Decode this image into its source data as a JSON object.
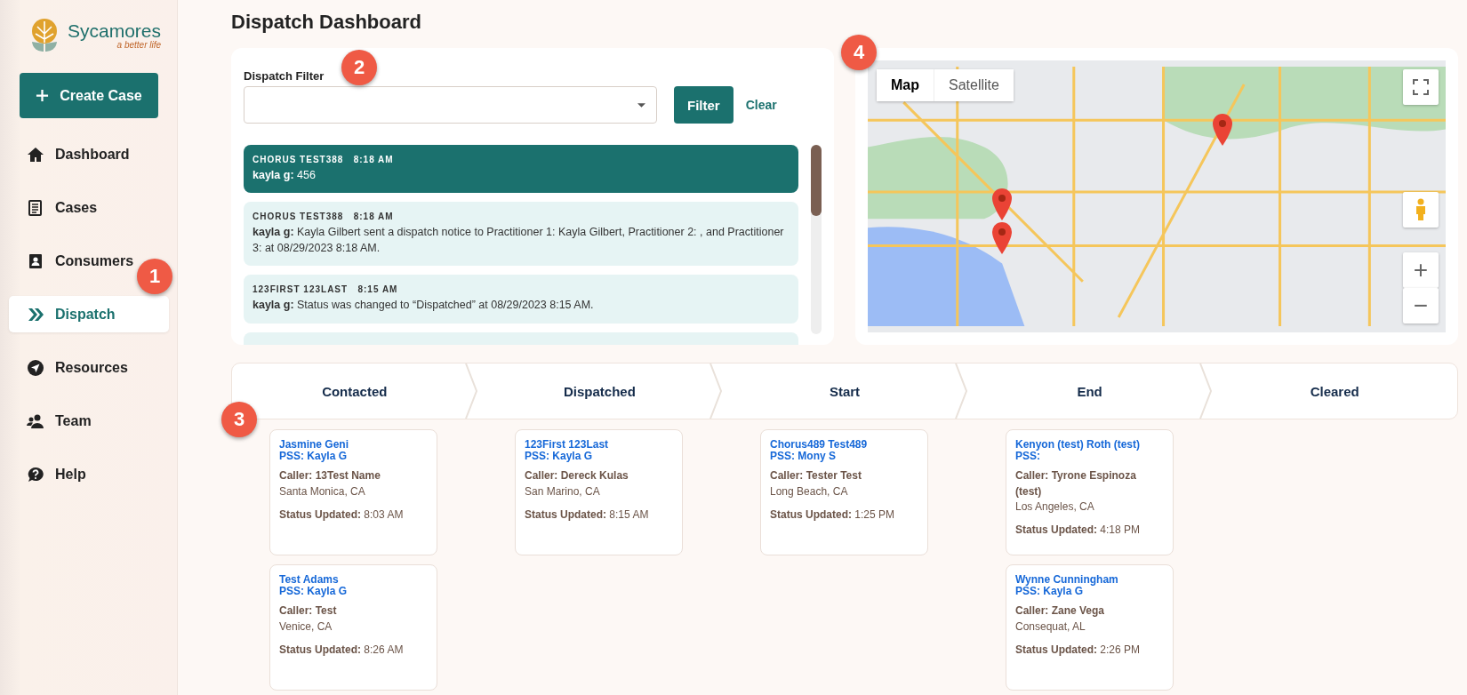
{
  "brand": {
    "name": "Sycamores",
    "tagline": "a better life"
  },
  "create_button": {
    "label": "Create Case"
  },
  "nav": [
    {
      "label": "Dashboard",
      "kind": "home",
      "selected": false
    },
    {
      "label": "Cases",
      "kind": "cases",
      "selected": false
    },
    {
      "label": "Consumers",
      "kind": "consumers",
      "selected": false
    },
    {
      "label": "Dispatch",
      "kind": "dispatch",
      "selected": true
    },
    {
      "label": "Resources",
      "kind": "resources",
      "selected": false
    },
    {
      "label": "Team",
      "kind": "team",
      "selected": false
    },
    {
      "label": "Help",
      "kind": "help",
      "selected": false
    }
  ],
  "page_title": "Dispatch Dashboard",
  "filter": {
    "label": "Dispatch Filter",
    "filter_button": "Filter",
    "clear_link": "Clear"
  },
  "messages": [
    {
      "header": "CHORUS TEST388   8:18 AM",
      "body": "**kayla g:** 456",
      "selected": true
    },
    {
      "header": "CHORUS TEST388   8:18 AM",
      "body": "**kayla g:** Kayla Gilbert sent a dispatch notice to Practitioner 1: Kayla Gilbert, Practitioner 2: , and Practitioner 3: at 08/29/2023 8:18 AM.",
      "selected": false
    },
    {
      "header": "123FIRST 123LAST   8:15 AM",
      "body": "**kayla g:** Status was changed to “Dispatched” at 08/29/2023 8:15 AM.",
      "selected": false
    }
  ],
  "map": {
    "tabs": [
      {
        "label": "Map",
        "selected": true
      },
      {
        "label": "Satellite",
        "selected": false
      }
    ],
    "zoom_in": "+",
    "zoom_out": "−"
  },
  "stages": [
    {
      "title": "Contacted",
      "cards": [
        {
          "name": "Jasmine Geni",
          "pss": "PSS: Kayla G",
          "caller": "Caller: 13Test Name",
          "location": "Santa Monica, CA",
          "status": "**Status Updated:** 8:03 AM"
        },
        {
          "name": "Test Adams",
          "pss": "PSS: Kayla G",
          "caller": "Caller: Test",
          "location": "Venice, CA",
          "status": "**Status Updated:** 8:26 AM"
        }
      ]
    },
    {
      "title": "Dispatched",
      "cards": [
        {
          "name": "123First 123Last",
          "pss": "PSS: Kayla G",
          "caller": "Caller: Dereck Kulas",
          "location": "San Marino, CA",
          "status": "**Status Updated:** 8:15 AM"
        }
      ]
    },
    {
      "title": "Start",
      "cards": [
        {
          "name": "Chorus489 Test489",
          "pss": "PSS: Mony S",
          "caller": "Caller: Tester Test",
          "location": "Long Beach, CA",
          "status": "**Status Updated:** 1:25 PM"
        }
      ]
    },
    {
      "title": "End",
      "cards": [
        {
          "name": "Kenyon (test) Roth (test)",
          "pss": "PSS:",
          "caller": "Caller: Tyrone Espinoza (test)",
          "location": "Los Angeles, CA",
          "status": "**Status Updated:** 4:18 PM"
        },
        {
          "name": "Wynne Cunningham",
          "pss": "PSS: Kayla G",
          "caller": "Caller: Zane Vega",
          "location": "Consequat, AL",
          "status": "**Status Updated:** 2:26 PM"
        }
      ]
    },
    {
      "title": "Cleared"
    }
  ],
  "callouts": [
    "1",
    "2",
    "3",
    "4"
  ]
}
